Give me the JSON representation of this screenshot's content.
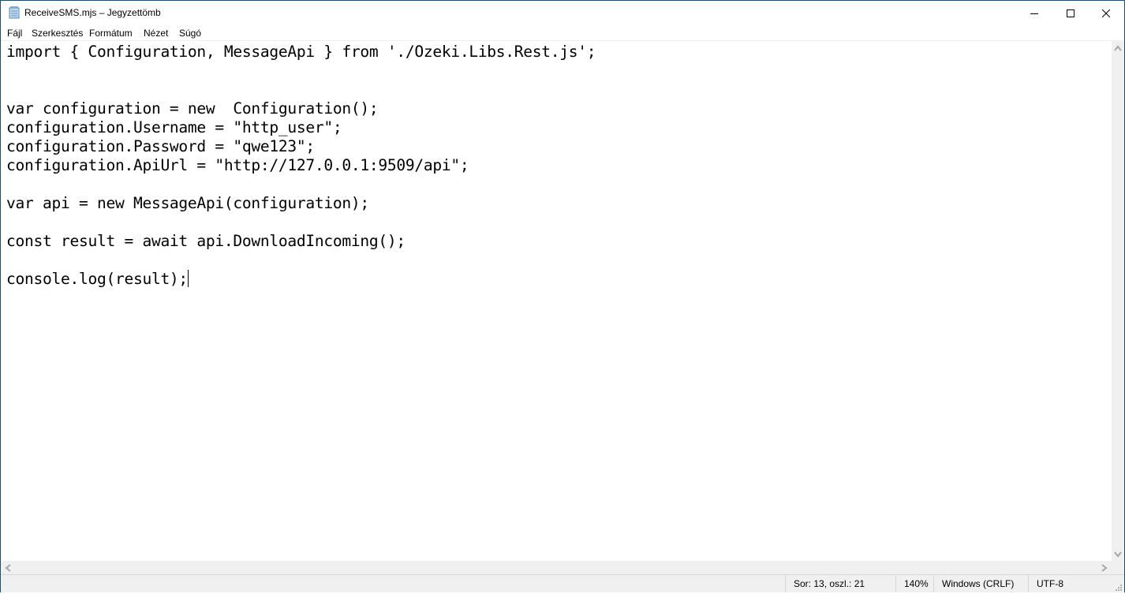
{
  "window": {
    "title": "ReceiveSMS.mjs – Jegyzettömb",
    "app_icon": "notepad-icon",
    "controls": {
      "minimize": "minimize-icon",
      "maximize": "maximize-icon",
      "close": "close-icon"
    }
  },
  "menu": {
    "items": [
      {
        "label": "Fájl"
      },
      {
        "label": "Szerkesztés"
      },
      {
        "label": "Formátum"
      },
      {
        "label": "Nézet"
      },
      {
        "label": "Súgó"
      }
    ]
  },
  "editor": {
    "lines": [
      "import { Configuration, MessageApi } from './Ozeki.Libs.Rest.js';",
      "",
      "",
      "var configuration = new  Configuration();",
      "configuration.Username = \"http_user\";",
      "configuration.Password = \"qwe123\";",
      "configuration.ApiUrl = \"http://127.0.0.1:9509/api\";",
      "",
      "var api = new MessageApi(configuration);",
      "",
      "const result = await api.DownloadIncoming();",
      "",
      "console.log(result);"
    ]
  },
  "statusbar": {
    "position": "Sor: 13, oszl.: 21",
    "zoom": "140%",
    "line_ending": "Windows (CRLF)",
    "encoding": "UTF-8"
  },
  "colors": {
    "border": "#1b4f6b",
    "chrome": "#f0f0f0",
    "scroll_arrow": "#a6a6a6"
  }
}
